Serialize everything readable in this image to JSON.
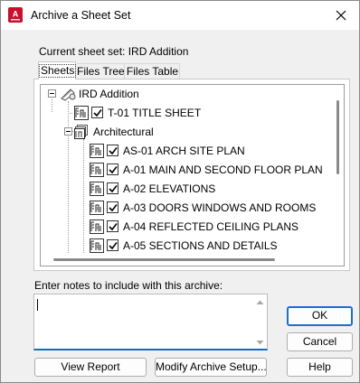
{
  "window": {
    "title": "Archive a Sheet Set",
    "close_symbol": "✕"
  },
  "current_set": {
    "text": "Current sheet set: IRD Addition"
  },
  "tabs": [
    {
      "label": "Sheets",
      "active": true
    },
    {
      "label": "Files Tree",
      "active": false
    },
    {
      "label": "Files Table",
      "active": false
    }
  ],
  "tree": {
    "root": {
      "label": "IRD Addition",
      "icon": "sheet-set-icon",
      "expanded": true
    },
    "items": [
      {
        "label": "T-01 TITLE SHEET",
        "checked": true,
        "type": "sheet"
      },
      {
        "label": "Architectural",
        "type": "subset",
        "expanded": true
      },
      {
        "label": "AS-01 ARCH SITE PLAN",
        "checked": true,
        "type": "sheet"
      },
      {
        "label": "A-01 MAIN AND SECOND FLOOR PLAN",
        "checked": true,
        "type": "sheet"
      },
      {
        "label": "A-02 ELEVATIONS",
        "checked": true,
        "type": "sheet"
      },
      {
        "label": "A-03 DOORS WINDOWS AND ROOMS",
        "checked": true,
        "type": "sheet"
      },
      {
        "label": "A-04 REFLECTED CEILING PLANS",
        "checked": true,
        "type": "sheet"
      },
      {
        "label": "A-05 SECTIONS AND DETAILS",
        "checked": true,
        "type": "sheet"
      }
    ]
  },
  "notes": {
    "label": "Enter notes to include with this archive:",
    "value": ""
  },
  "buttons": {
    "view_report": "View Report",
    "modify_setup": "Modify Archive Setup...",
    "ok": "OK",
    "cancel": "Cancel",
    "help": "Help"
  },
  "colors": {
    "app_icon_red": "#c8102e",
    "focus_blue": "#1f6fc5",
    "dialog_bg": "#f0f0f0"
  }
}
